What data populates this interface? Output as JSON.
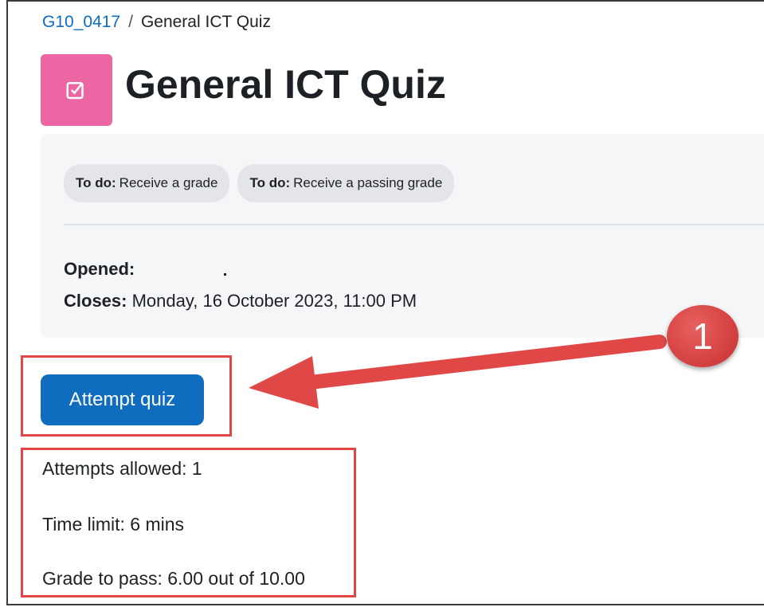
{
  "breadcrumb": {
    "course": "G10_0417",
    "separator": "/",
    "current": "General ICT Quiz"
  },
  "page": {
    "title": "General ICT Quiz",
    "icon": "quiz-icon",
    "icon_color": "#eb66a2"
  },
  "completion": {
    "badges": [
      {
        "prefix": "To do:",
        "text": "Receive a grade"
      },
      {
        "prefix": "To do:",
        "text": "Receive a passing grade"
      }
    ]
  },
  "dates": {
    "opened_label": "Opened:",
    "closes_label": "Closes:",
    "closes_value": "Monday, 16 October 2023, 11:00 PM"
  },
  "actions": {
    "attempt_label": "Attempt quiz",
    "accent": "#0f6cbf"
  },
  "quiz_info": {
    "attempts_allowed": "Attempts allowed: 1",
    "time_limit": "Time limit: 6 mins",
    "grade_to_pass": "Grade to pass: 6.00 out of 10.00"
  },
  "annotation": {
    "step_number": "1",
    "color": "#e04848"
  }
}
